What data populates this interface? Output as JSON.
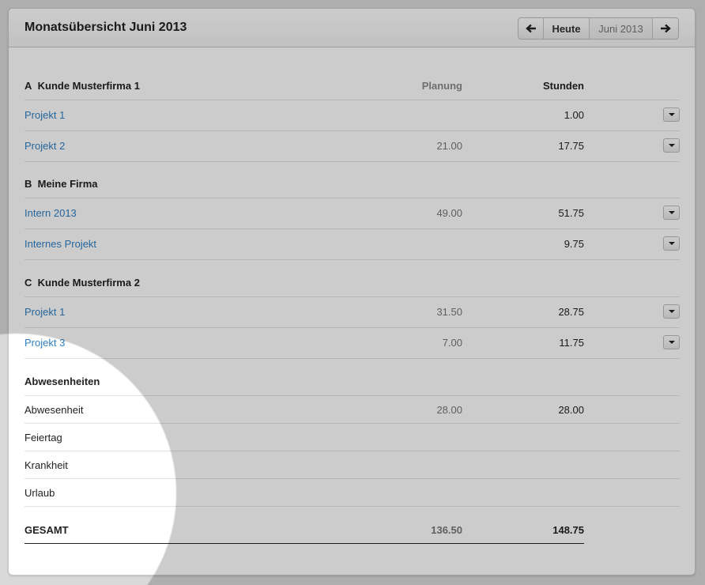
{
  "header": {
    "title": "Monatsübersicht Juni 2013",
    "nav": {
      "prev_icon": "arrow-left-icon",
      "today_label": "Heute",
      "period_label": "Juni 2013",
      "next_icon": "arrow-right-icon"
    }
  },
  "columns": {
    "planning": "Planung",
    "hours": "Stunden"
  },
  "groups": [
    {
      "letter": "A",
      "name": "Kunde Musterfirma 1",
      "projects": [
        {
          "name": "Projekt 1",
          "planned": "",
          "hours": "1.00"
        },
        {
          "name": "Projekt 2",
          "planned": "21.00",
          "hours": "17.75"
        }
      ]
    },
    {
      "letter": "B",
      "name": "Meine Firma",
      "projects": [
        {
          "name": "Intern 2013",
          "planned": "49.00",
          "hours": "51.75"
        },
        {
          "name": "Internes Projekt",
          "planned": "",
          "hours": "9.75"
        }
      ]
    },
    {
      "letter": "C",
      "name": "Kunde Musterfirma 2",
      "projects": [
        {
          "name": "Projekt 1",
          "planned": "31.50",
          "hours": "28.75"
        },
        {
          "name": "Projekt 3",
          "planned": "7.00",
          "hours": "11.75"
        }
      ]
    }
  ],
  "absences": {
    "title": "Abwesenheiten",
    "items": [
      {
        "name": "Abwesenheit",
        "planned": "28.00",
        "hours": "28.00"
      },
      {
        "name": "Feiertag",
        "planned": "",
        "hours": ""
      },
      {
        "name": "Krankheit",
        "planned": "",
        "hours": ""
      },
      {
        "name": "Urlaub",
        "planned": "",
        "hours": ""
      }
    ]
  },
  "total": {
    "label": "GESAMT",
    "planned": "136.50",
    "hours": "148.75"
  },
  "colors": {
    "link": "#2f7fc4",
    "muted": "#777777",
    "overlay": "rgba(0,0,0,0.2)"
  }
}
